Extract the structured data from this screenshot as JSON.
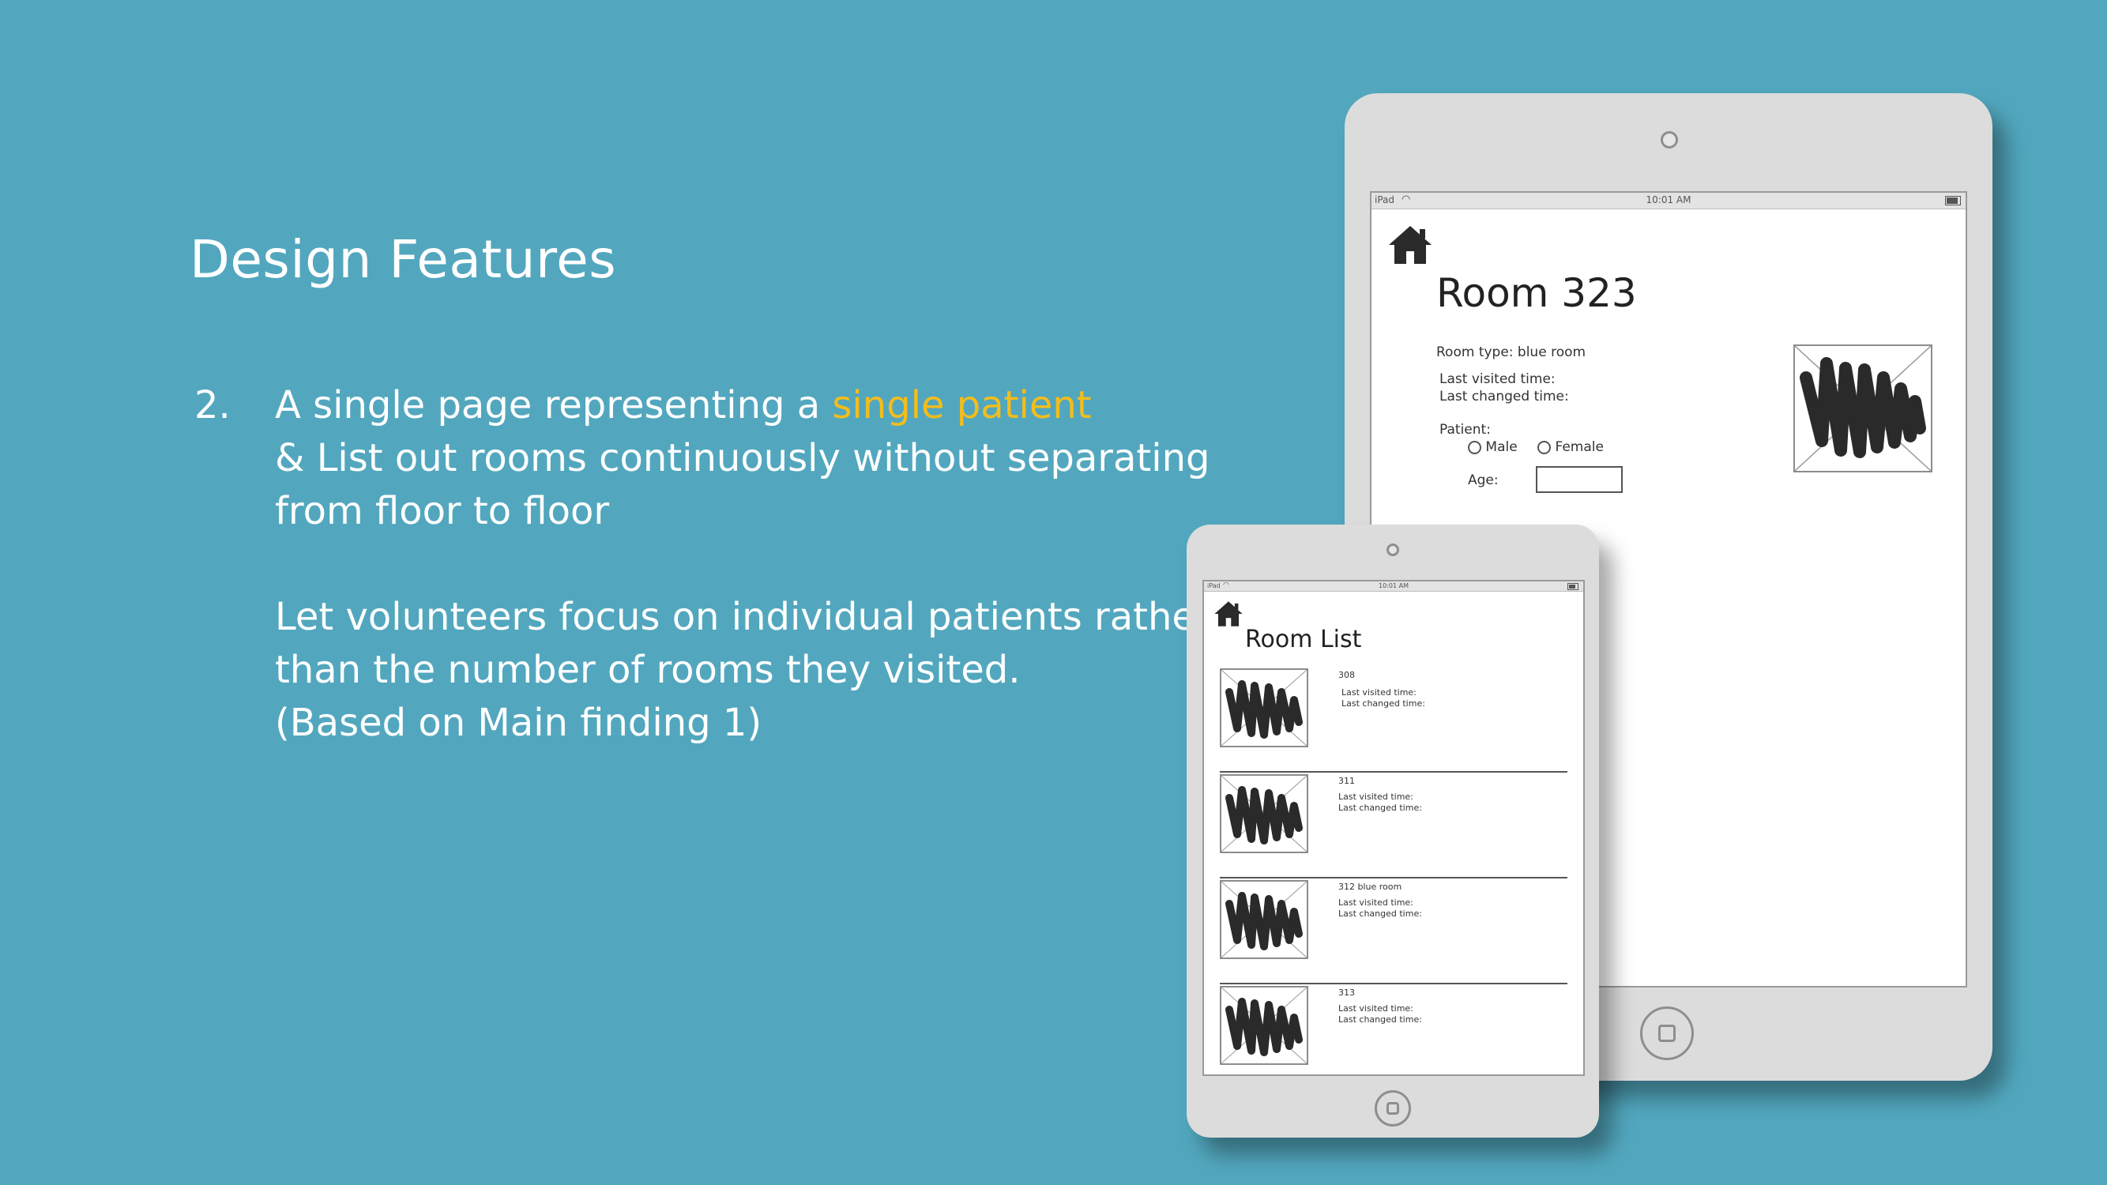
{
  "slide": {
    "title": "Design Features",
    "item_number": "2.",
    "line1_prefix": "A single page representing a ",
    "line1_highlight": "single patient",
    "line2": "& List out rooms continuously without separating",
    "line3": "from floor to floor",
    "line4": "Let volunteers focus on individual patients rather",
    "line5": "than the number of rooms they visited.",
    "line6": "(Based on Main finding 1)",
    "highlight_color": "#f3bd1c",
    "background_color": "#52a7be"
  },
  "room_page": {
    "status_carrier": "iPad",
    "status_time": "10:01 AM",
    "home_icon": "house-icon",
    "title": "Room 323",
    "room_type": "Room type: blue room",
    "last_visited": "Last visited time:",
    "last_changed": "Last changed time:",
    "patient_label": "Patient:",
    "male_label": "Male",
    "female_label": "Female",
    "age_label": "Age:"
  },
  "room_list": {
    "status_carrier": "iPad",
    "status_time": "10:01 AM",
    "home_icon": "house-icon",
    "title": "Room List",
    "rows": [
      {
        "room": "308",
        "visited": "Last visited time:",
        "changed": "Last changed time:"
      },
      {
        "room": "311",
        "visited": "Last visited time:",
        "changed": "Last changed time:"
      },
      {
        "room": "312 blue room",
        "visited": "Last visited time:",
        "changed": "Last changed time:"
      },
      {
        "room": "313",
        "visited": "Last visited time:",
        "changed": "Last changed time:"
      }
    ]
  }
}
